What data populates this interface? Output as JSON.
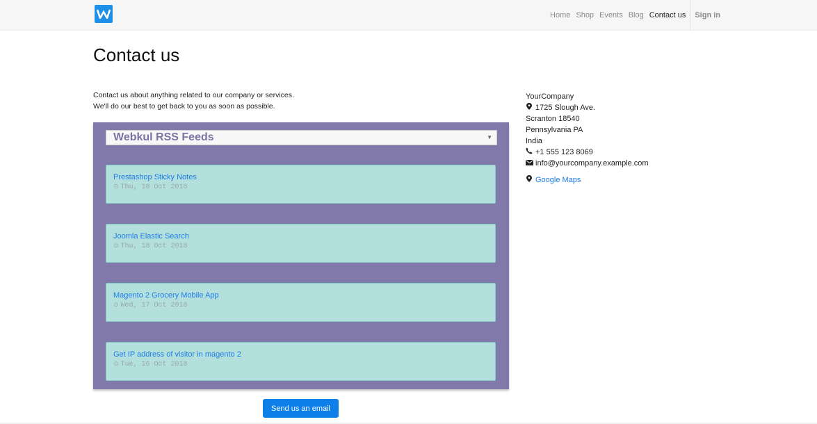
{
  "nav": {
    "items": [
      "Home",
      "Shop",
      "Events",
      "Blog",
      "Contact us"
    ],
    "active": "Contact us",
    "signin": "Sign in"
  },
  "page": {
    "title": "Contact us",
    "intro_line1": "Contact us about anything related to our company or services.",
    "intro_line2": "We'll do our best to get back to you as soon as possible."
  },
  "rss": {
    "selected_feed": "Webkul RSS Feeds",
    "items": [
      {
        "title": "Prestashop Sticky Notes",
        "date": "Thu, 18 Oct 2018"
      },
      {
        "title": "Joomla Elastic Search",
        "date": "Thu, 18 Oct 2018"
      },
      {
        "title": "Magento 2 Grocery Mobile App",
        "date": "Wed, 17 Oct 2018"
      },
      {
        "title": "Get IP address of visitor in magento 2",
        "date": "Tue, 16 Oct 2018"
      }
    ]
  },
  "send_button": "Send us an email",
  "company": {
    "name": "YourCompany",
    "street": "1725 Slough Ave.",
    "city": "Scranton 18540",
    "state": "Pennsylvania PA",
    "country": "India",
    "phone": "+1 555 123 8069",
    "email": "info@yourcompany.example.com",
    "maps_link": "Google Maps"
  },
  "colors": {
    "accent": "#0d7fe8",
    "rss_background": "#8079aa",
    "card_background": "#b3e0dc",
    "link": "#1e7be6"
  },
  "icons": {
    "logo": "w-logo-icon",
    "marker": "map-marker-icon",
    "phone": "phone-icon",
    "email": "envelope-icon",
    "clock": "clock-icon",
    "select_arrow": "caret-down-icon"
  }
}
